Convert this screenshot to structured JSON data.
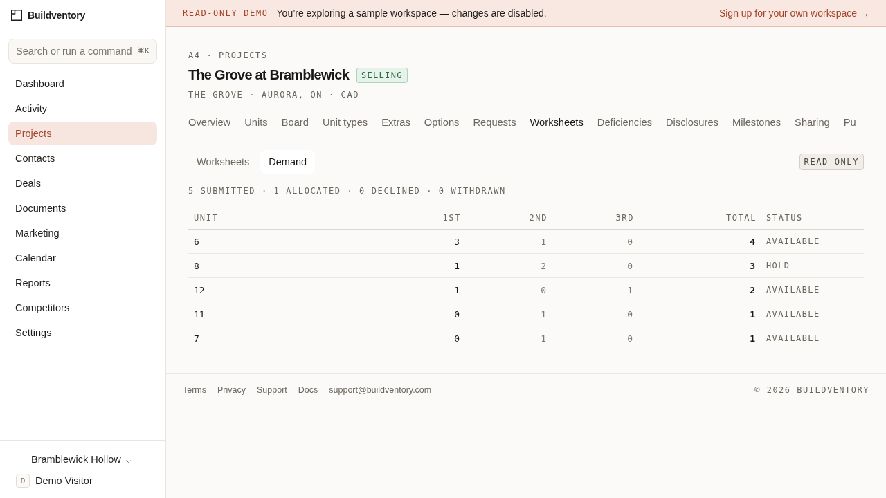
{
  "sidebar": {
    "brand": "Buildventory",
    "search": {
      "placeholder": "Search or run a command",
      "shortcut": "⌘K"
    },
    "items": [
      {
        "label": "Dashboard",
        "selected": false
      },
      {
        "label": "Activity",
        "selected": false
      },
      {
        "label": "Projects",
        "selected": true
      },
      {
        "label": "Contacts",
        "selected": false
      },
      {
        "label": "Deals",
        "selected": false
      },
      {
        "label": "Documents",
        "selected": false
      },
      {
        "label": "Marketing",
        "selected": false
      },
      {
        "label": "Calendar",
        "selected": false
      },
      {
        "label": "Reports",
        "selected": false
      },
      {
        "label": "Competitors",
        "selected": false
      },
      {
        "label": "Settings",
        "selected": false
      }
    ],
    "workspace": "Bramblewick Hollow",
    "user": {
      "initial": "D",
      "name": "Demo Visitor"
    }
  },
  "banner": {
    "tag": "READ-ONLY DEMO",
    "message": "You’re exploring a sample workspace — changes are disabled.",
    "link": "Sign up for your own workspace →"
  },
  "page": {
    "breadcrumb": "A4 · PROJECTS",
    "title": "The Grove at Bramblewick",
    "status_badge": "SELLING",
    "subtitle": "THE-GROVE · AURORA, ON · CAD"
  },
  "tabs": [
    {
      "label": "Overview",
      "selected": false
    },
    {
      "label": "Units",
      "selected": false
    },
    {
      "label": "Board",
      "selected": false
    },
    {
      "label": "Unit types",
      "selected": false
    },
    {
      "label": "Extras",
      "selected": false
    },
    {
      "label": "Options",
      "selected": false
    },
    {
      "label": "Requests",
      "selected": false
    },
    {
      "label": "Worksheets",
      "selected": true
    },
    {
      "label": "Deficiencies",
      "selected": false
    },
    {
      "label": "Disclosures",
      "selected": false
    },
    {
      "label": "Milestones",
      "selected": false
    },
    {
      "label": "Sharing",
      "selected": false
    },
    {
      "label": "Pu",
      "selected": false
    }
  ],
  "subtabs": [
    {
      "label": "Worksheets",
      "selected": false
    },
    {
      "label": "Demand",
      "selected": true
    }
  ],
  "mode_badge": "READ ONLY",
  "summary": "5 SUBMITTED · 1 ALLOCATED · 0 DECLINED · 0 WITHDRAWN",
  "table": {
    "columns": [
      {
        "label": "UNIT",
        "kind": "unit"
      },
      {
        "label": "1ST",
        "kind": "first"
      },
      {
        "label": "2ND",
        "kind": "count"
      },
      {
        "label": "3RD",
        "kind": "count"
      },
      {
        "label": "TOTAL",
        "kind": "total"
      },
      {
        "label": "STATUS",
        "kind": "status"
      }
    ],
    "rows": [
      [
        "6",
        "3",
        "1",
        "0",
        "4",
        "AVAILABLE"
      ],
      [
        "8",
        "1",
        "2",
        "0",
        "3",
        "HOLD"
      ],
      [
        "12",
        "1",
        "0",
        "1",
        "2",
        "AVAILABLE"
      ],
      [
        "11",
        "0",
        "1",
        "0",
        "1",
        "AVAILABLE"
      ],
      [
        "7",
        "0",
        "1",
        "0",
        "1",
        "AVAILABLE"
      ]
    ]
  },
  "footer": {
    "links": [
      "Terms",
      "Privacy",
      "Support",
      "Docs",
      "support@buildventory.com"
    ],
    "copyright": "© 2026 BUILDVENTORY"
  }
}
